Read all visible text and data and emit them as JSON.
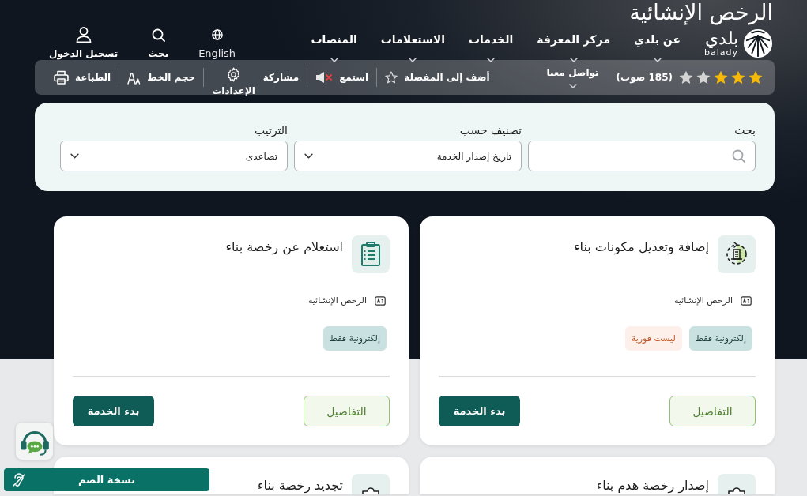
{
  "page_title": "الرخص الإنشائية",
  "header": {
    "logo": {
      "wordmark": "بلدي",
      "latin": "balady"
    },
    "nav": [
      {
        "label": "عن بلدي"
      },
      {
        "label": "مركز المعرفة"
      },
      {
        "label": "الخدمات"
      },
      {
        "label": "الاستعلامات"
      },
      {
        "label": "المنصات"
      }
    ],
    "utilities": [
      {
        "kind": "language",
        "label": "English"
      },
      {
        "kind": "search",
        "label": "بحث"
      },
      {
        "kind": "login",
        "label": "تسجيل الدخول"
      }
    ]
  },
  "toolbar": {
    "rating": {
      "stars": 3,
      "votes": "(185 صوت)"
    },
    "contact": "تواصل معنا",
    "action_groups": [
      [
        {
          "kind": "favorite",
          "label": "أضف إلى المفضلة"
        }
      ],
      [
        {
          "kind": "listen",
          "label": "استمع"
        }
      ],
      [
        {
          "kind": "share",
          "label": "مشاركة"
        },
        {
          "kind": "settings",
          "label": "الإعدادات"
        }
      ],
      [
        {
          "kind": "font_size",
          "label": "حجم الخط"
        }
      ],
      [
        {
          "kind": "print",
          "label": "الطباعة"
        }
      ]
    ]
  },
  "filters": [
    {
      "kind": "search",
      "label": "بحث"
    },
    {
      "kind": "select",
      "label": "تصنيف حسب",
      "value": "تاريخ إصدار الخدمة"
    },
    {
      "kind": "select",
      "label": "الترتيب",
      "value": "تصاعدى"
    }
  ],
  "cards": [
    {
      "kind": "modify",
      "title": "إضافة وتعديل مكونات بناء",
      "category": "الرخص الإنشائية",
      "tags": [
        {
          "kind": "electronic",
          "label": "إلكترونية فقط"
        },
        {
          "kind": "not_instant",
          "label": "ليست فورية"
        }
      ],
      "details": "التفاصيل",
      "start": "بدء الخدمة"
    },
    {
      "kind": "inquiry",
      "title": "استعلام عن رخصة بناء",
      "category": "الرخص الإنشائية",
      "tags": [
        {
          "kind": "electronic",
          "label": "إلكترونية فقط"
        }
      ],
      "details": "التفاصيل",
      "start": "بدء الخدمة"
    },
    {
      "kind": "demolition",
      "title": "إصدار رخصة هدم بناء"
    },
    {
      "kind": "renewal",
      "title": "تجديد رخصة بناء"
    }
  ],
  "floating": {
    "deaf_version": "نسخة الصم"
  }
}
